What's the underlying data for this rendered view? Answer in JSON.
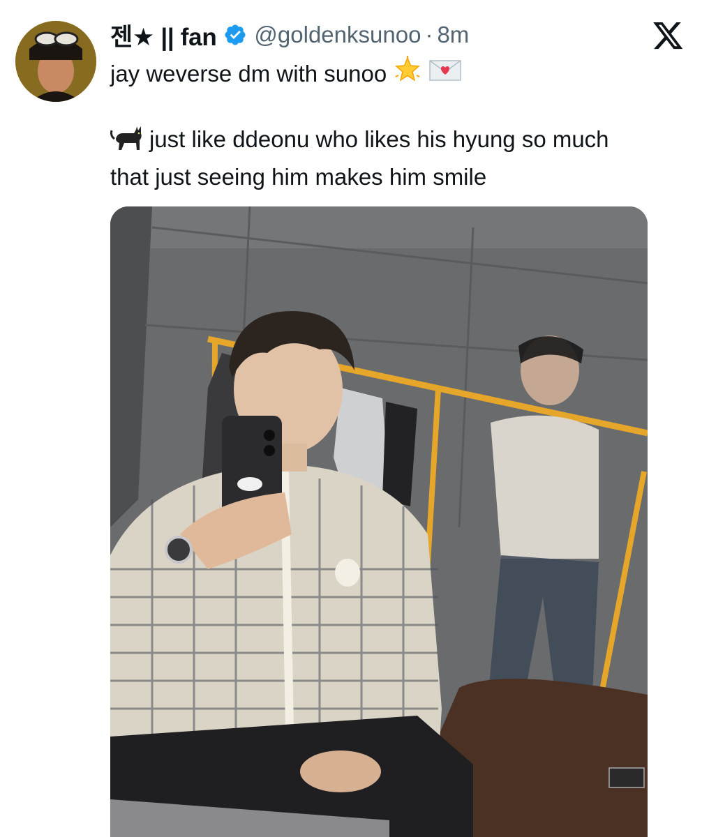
{
  "tweet": {
    "display_name": "젠★ || fan",
    "handle": "@goldenksunoo",
    "separator": "·",
    "time": "8m",
    "line1": "jay weverse dm with sunoo",
    "body_text": "just like ddeonu who likes his hyung so much that just seeing him makes him smile",
    "avatar_icon": "avatar-image",
    "verified_icon": "verified-badge-icon",
    "platform_icon": "x-logo-icon",
    "media_icon": "photo-image",
    "colors": {
      "text_primary": "#0f1419",
      "text_secondary": "#536471",
      "verified_blue": "#1d9bf0"
    }
  }
}
